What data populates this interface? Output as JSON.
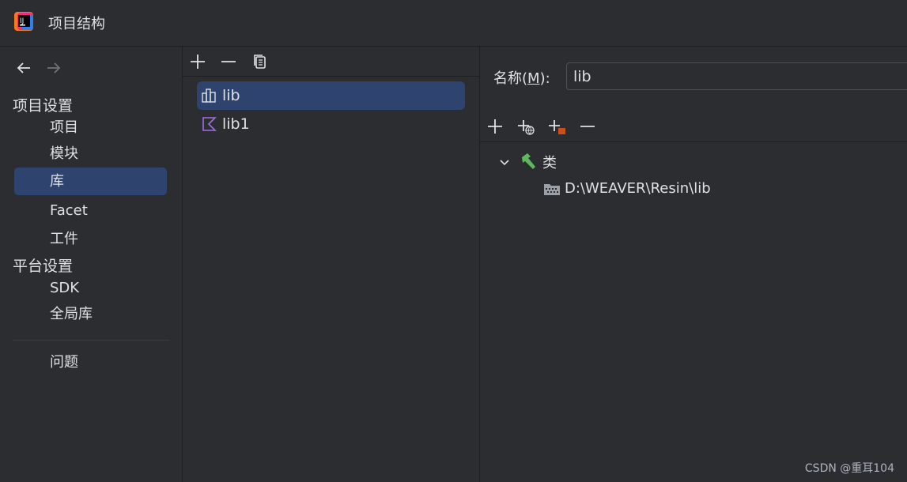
{
  "window": {
    "title": "项目结构"
  },
  "sidebar": {
    "project_settings_heading": "项目设置",
    "project_items": [
      {
        "label": "项目",
        "selected": false
      },
      {
        "label": "模块",
        "selected": false
      },
      {
        "label": "库",
        "selected": true
      },
      {
        "label": "Facet",
        "selected": false
      },
      {
        "label": "工件",
        "selected": false
      }
    ],
    "platform_settings_heading": "平台设置",
    "platform_items": [
      {
        "label": "SDK",
        "selected": false
      },
      {
        "label": "全局库",
        "selected": false
      }
    ],
    "problems_label": "问题"
  },
  "libraries": {
    "toolbar_icons": [
      "add-icon",
      "remove-icon",
      "copy-icon"
    ],
    "items": [
      {
        "label": "lib",
        "icon": "library-icon",
        "selected": true
      },
      {
        "label": "lib1",
        "icon": "kotlin-library-icon",
        "selected": false
      }
    ]
  },
  "details": {
    "name_label_prefix": "名称(",
    "name_mnemonic": "M",
    "name_label_suffix": "):",
    "name_value": "lib",
    "toolbar_icons": [
      "add-icon",
      "add-url-icon",
      "add-jar-icon",
      "remove-icon"
    ],
    "tree": {
      "classes_label": "类",
      "classes_icon": "hammer-icon",
      "path": "D:\\WEAVER\\Resin\\lib",
      "path_icon": "jar-directory-icon"
    }
  },
  "watermark": "CSDN @重耳104",
  "colors": {
    "background": "#2b2d30",
    "selection": "#2e436e",
    "text": "#dfe1e5",
    "kotlin": "#9f6fe3",
    "hammer": "#5fb85c"
  }
}
